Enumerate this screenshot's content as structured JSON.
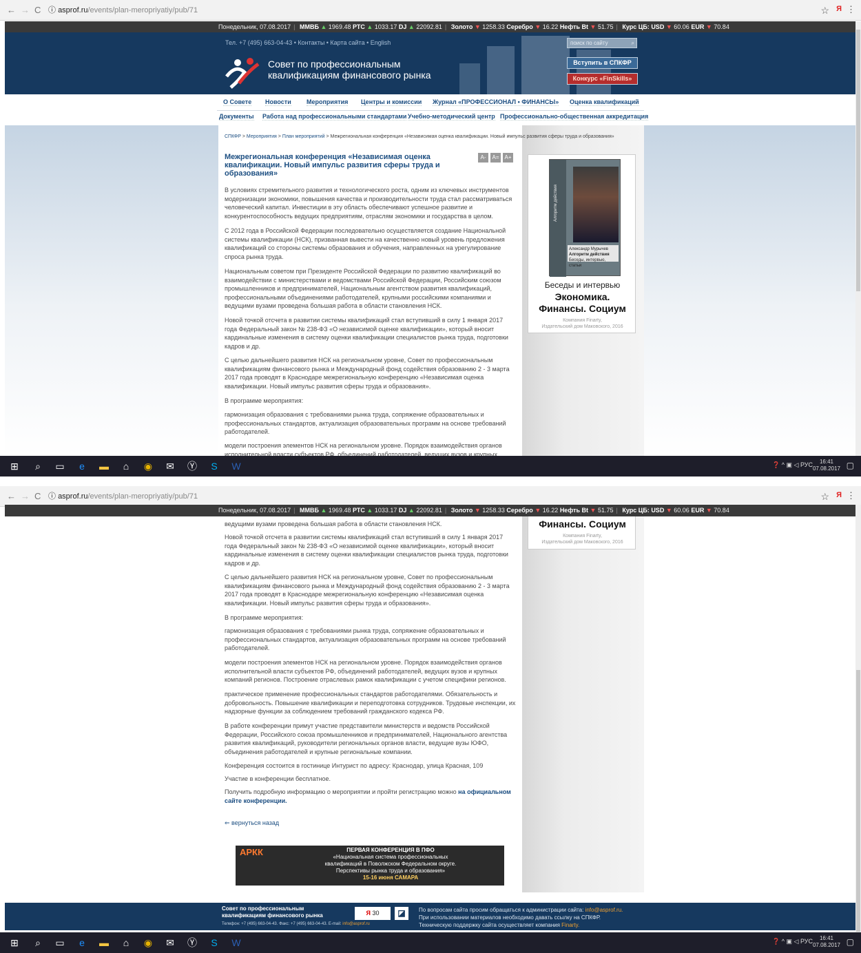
{
  "browser": {
    "url_host": "asprof.ru",
    "url_path": "/events/plan-meropriyatiy/pub/71",
    "back": "←",
    "forward": "→",
    "reload": "C",
    "info": "ⓘ",
    "star": "☆",
    "menu": "⋮",
    "ext": "Я"
  },
  "ticker": {
    "date": "Понедельник, 07.08.2017",
    "mmvb_label": "ММВБ",
    "mmvb": "1969.48",
    "rts_label": "РТС",
    "rts": "1033.17",
    "dj_label": "DJ",
    "dj": "22092.81",
    "gold_label": "Золото",
    "gold": "1258.33",
    "silver_label": "Серебро",
    "silver": "16.22",
    "oil_label": "Нефть Bt",
    "oil": "51.75",
    "rate_label": "Курс ЦБ:",
    "usd_label": "USD",
    "usd": "60.06",
    "eur_label": "EUR",
    "eur": "70.84"
  },
  "header": {
    "phone_links": "Тел. +7 (495) 663-04-43  •  Контакты  •  Карта сайта  •  English",
    "title_line1": "Совет по профессиональным",
    "title_line2": "квалификациям финансового рынка",
    "search_placeholder": "поиск по сайту",
    "join_button": "Вступить в СПКФР",
    "contest_button": "Конкурс «FinSkills»"
  },
  "menu1": [
    "О Совете",
    "Новости",
    "Мероприятия",
    "Центры и комиссии",
    "Журнал «ПРОФЕССИОНАЛ • ФИНАНСЫ»",
    "Оценка квалификаций"
  ],
  "menu2": [
    "Документы",
    "Работа над профессиональными стандартами",
    "Учебно-методический центр",
    "Профессионально-общественная аккредитация"
  ],
  "breadcrumb": {
    "items": [
      "СПКФР",
      "Мероприятия",
      "План мероприятий"
    ],
    "current": "Межрегиональная конференция «Независимая оценка квалификации. Новый импульс развития сферы труда и образования»",
    "sep": ">"
  },
  "article": {
    "title": "Межрегиональная конференция «Независимая оценка квалификации. Новый импульс развития сферы труда и образования»",
    "font_buttons": [
      "A-",
      "A=",
      "A+"
    ],
    "p1": "В условиях стремительного развития и технологического роста, одним из ключевых инструментов модернизации экономики, повышения качества и производительности труда стал рассматриваться человеческий капитал. Инвестиции в эту область обеспечивают успешное развитие и конкурентоспособность ведущих предприятиям, отраслям экономики и государства в целом.",
    "p2": "С 2012 года в Российской Федерации последовательно осуществляется создание Национальной системы квалификации (НСК), призванная вывести на качественно новый уровень предложения квалификаций со стороны системы образования и обучения, направленных на урегулирование спроса рынка труда.",
    "p3": "Национальным советом при Президенте Российской Федерации по развитию квалификаций во взаимодействии с министерствами и ведомствами Российской Федерации, Российским союзом промышленников и предпринимателей, Национальным агентством развития квалификаций, профессиональными объединениями работодателей, крупными российскими компаниями и ведущими вузами проведена большая работа в области становления НСК.",
    "p3_tail": "ведущими вузами проведена большая работа в области становления НСК.",
    "p4": "Новой точкой отсчета в развитии системы квалификаций стал вступивший в силу 1 января 2017 года Федеральный закон № 238-ФЗ «О независимой оценке квалификации», который вносит кардинальные изменения в систему оценки квалификации специалистов рынка труда, подготовки кадров и др.",
    "p5": "С целью дальнейшего развития НСК на региональном уровне, Совет по профессиональным квалификациям финансового рынка и Международный фонд содействия образованию 2 - 3 марта 2017 года проводят в Краснодаре межрегиональную конференцию «Независимая оценка квалификации. Новый импульс развития сферы труда и образования».",
    "p6": "В программе мероприятия:",
    "p7": "гармонизация образования с требованиями рынка труда, сопряжение образовательных и профессиональных стандартов, актуализация образовательных программ на основе требований работодателей.",
    "p8": "модели построения элементов НСК на региональном уровне. Порядок взаимодействия органов исполнительной власти субъектов РФ, объединений работодателей, ведущих вузов и крупных компаний регионов. Построение отраслевых рамок квалификации с учетом специфики регионов.",
    "p9": "практическое применение профессиональных стандартов работодателями. Обязательность и добровольность. Повышение квалификации и переподготовка сотрудников. Трудовые инспекции, их надзорные функции за соблюдением требований гражданского кодекса РФ.",
    "p10": "В работе конференции примут участие представители министерств и ведомств Российской Федерации, Российского союза промышленников и предпринимателей, Национального агентства развития квалификаций, руководители региональных органов власти, ведущие вузы ЮФО, объединения работодателей и крупные региональные компании.",
    "p11": "Конференция состоится в гостинице Интурист по адресу: Краснодар, улица Красная, 109",
    "p12": "Участие в конференции бесплатное.",
    "p13": "Получить подробную информацию о мероприятии и пройти регистрацию можно",
    "p13_link": "на официальном сайте конференции.",
    "back_link": "⇐ вернуться назад"
  },
  "book": {
    "cover_author": "Александр Мурычев",
    "cover_title": "Алгоритм действия",
    "cover_sub": "Беседы, интервью, статьи",
    "spine": "Алгоритм действия",
    "line1": "Беседы и интервью",
    "line2": "Экономика.",
    "line3": "Финансы. Социум",
    "pub1": "Компания Finarty,",
    "pub2": "Издательский дом Маковского, 2016"
  },
  "banner": {
    "logo": "АРКК",
    "line1": "ПЕРВАЯ КОНФЕРЕНЦИЯ В ПФО",
    "line2": "«Национальная система профессиональных",
    "line3": "квалификаций в Поволжском Федеральном округе.",
    "line4": "Перспективы рынка труда и образования»",
    "date": "15-16 июня САМАРА"
  },
  "footer": {
    "name1": "Совет по профессиональным",
    "name2": "квалификациям финансового рынка",
    "contacts": "Телефон: +7 (495) 663-04-43. Факс: +7 (495) 663-04-43. E-mail: ",
    "email": "info@asprof.ru",
    "counter": "30",
    "r1": "По вопросам сайта просим обращаться к администрации сайта: ",
    "r1_email": "info@asprof.ru.",
    "r2": "При использовании материалов необходимо давать ссылку на СПКФР.",
    "r3": "Техническую поддержку сайта осуществляет компания ",
    "r3_company": "Finarty."
  },
  "taskbar": {
    "lang": "РУС",
    "time": "16:41",
    "date": "07.08.2017"
  }
}
